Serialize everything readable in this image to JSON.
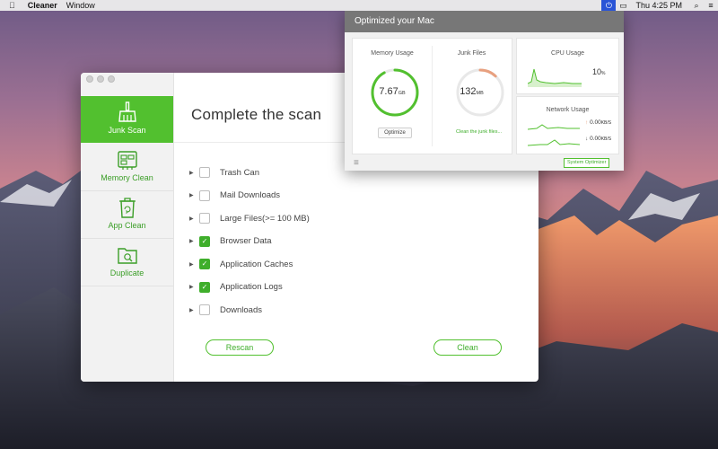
{
  "menubar": {
    "app_name": "Cleaner",
    "menus": [
      "Window"
    ],
    "clock": "Thu 4:25 PM"
  },
  "main_window": {
    "sidebar": {
      "items": [
        {
          "label": "Junk Scan",
          "icon": "broom-icon",
          "active": true
        },
        {
          "label": "Memory Clean",
          "icon": "memory-chip-icon",
          "active": false
        },
        {
          "label": "App Clean",
          "icon": "trash-recycle-icon",
          "active": false
        },
        {
          "label": "Duplicate",
          "icon": "folder-search-icon",
          "active": false
        }
      ]
    },
    "title": "Complete the scan",
    "scan_items": [
      {
        "label": "Trash Can",
        "checked": false
      },
      {
        "label": "Mail Downloads",
        "checked": false
      },
      {
        "label": "Large Files(>= 100 MB)",
        "checked": false
      },
      {
        "label": "Browser Data",
        "checked": true
      },
      {
        "label": "Application Caches",
        "checked": true
      },
      {
        "label": "Application Logs",
        "checked": true
      },
      {
        "label": "Downloads",
        "checked": false
      }
    ],
    "rescan_label": "Rescan",
    "clean_label": "Clean"
  },
  "optimizer": {
    "title": "Optimized your Mac",
    "memory": {
      "title": "Memory Usage",
      "value": "7.67",
      "unit": "GB",
      "fraction": 0.92,
      "button": "Optimize"
    },
    "junk": {
      "title": "Junk Files",
      "value": "132",
      "unit": "MB",
      "fraction": 0.12,
      "link": "Clean the junk files..."
    },
    "cpu": {
      "title": "CPU Usage",
      "value": "10",
      "unit": "%"
    },
    "network": {
      "title": "Network Usage",
      "up": {
        "value": "0.00",
        "unit": "KB/S"
      },
      "down": {
        "value": "0.00",
        "unit": "KB/S"
      }
    },
    "footer_button": "System Optimizer"
  },
  "colors": {
    "accent": "#52c02f",
    "accent_dark": "#3fae2b",
    "junk_ring": "#e8a07f",
    "panel_header": "#777777"
  }
}
